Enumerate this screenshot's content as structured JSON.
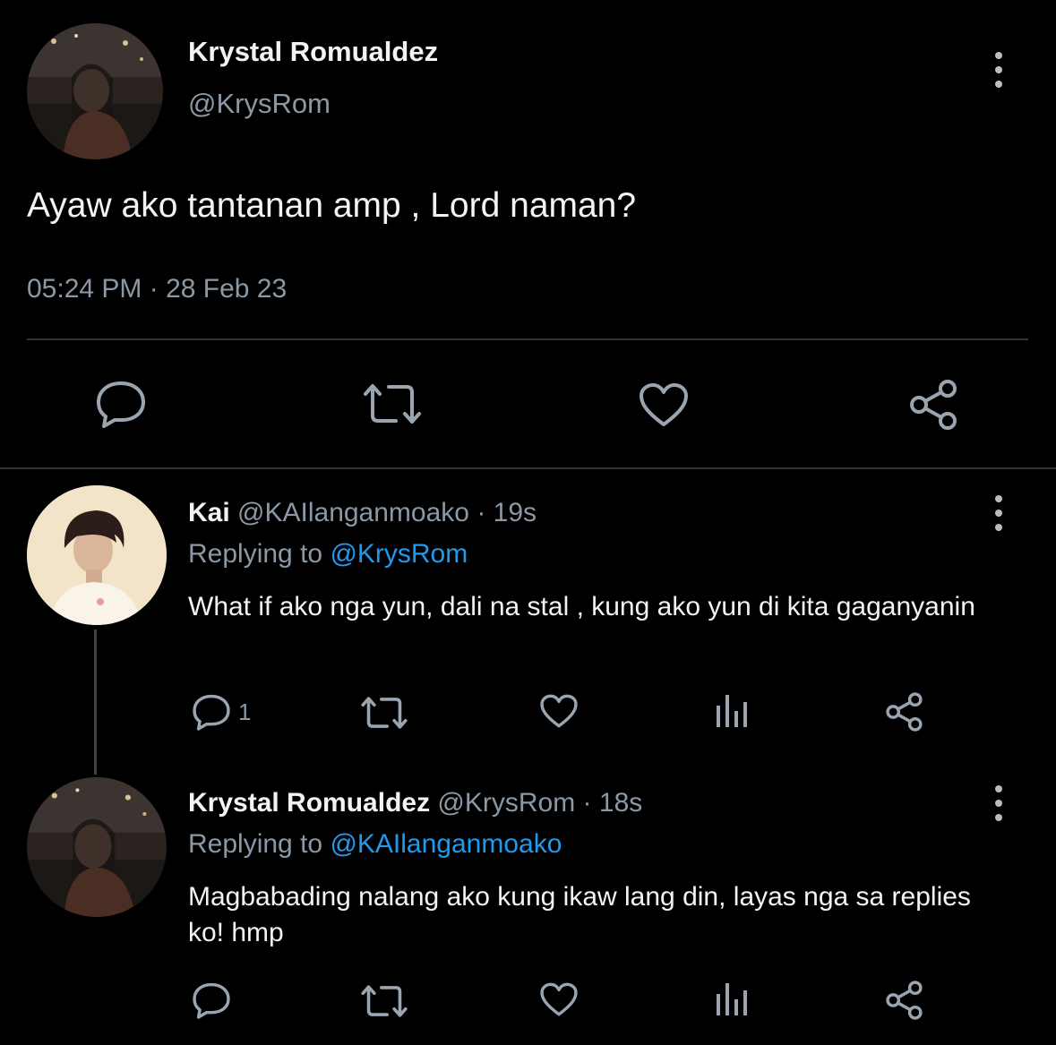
{
  "main_tweet": {
    "author_name": "Krystal Romualdez",
    "handle": "@KrysRom",
    "text": "Ayaw ako tantanan amp , Lord naman?",
    "timestamp": "05:24 PM · 28 Feb 23",
    "actions": [
      "reply-icon",
      "retweet-icon",
      "like-icon",
      "share-icon"
    ]
  },
  "replies": [
    {
      "author_name": "Kai",
      "handle": "@KAIlanganmoako",
      "sep": " · ",
      "time": "19s",
      "replying_label": "Replying to",
      "replying_to": "@KrysRom",
      "text": "What if ako nga yun, dali na stal , kung ako yun di kita gaganyanin",
      "reply_count": "1",
      "actions": [
        "reply-icon",
        "retweet-icon",
        "like-icon",
        "analytics-icon",
        "share-icon"
      ]
    },
    {
      "author_name": "Krystal Romualdez",
      "handle": "@KrysRom",
      "sep": " · ",
      "time": "18s",
      "replying_label": "Replying to",
      "replying_to": "@KAIlanganmoako",
      "text": "Magbabading nalang ako kung ikaw lang din, layas nga sa replies ko! hmp",
      "reply_count": "",
      "actions": [
        "reply-icon",
        "retweet-icon",
        "like-icon",
        "analytics-icon",
        "share-icon"
      ]
    }
  ],
  "colors": {
    "background": "#000000",
    "text": "#e7e9ea",
    "muted": "#8b98a5",
    "link": "#1d9bf0",
    "divider": "#2f3336"
  }
}
